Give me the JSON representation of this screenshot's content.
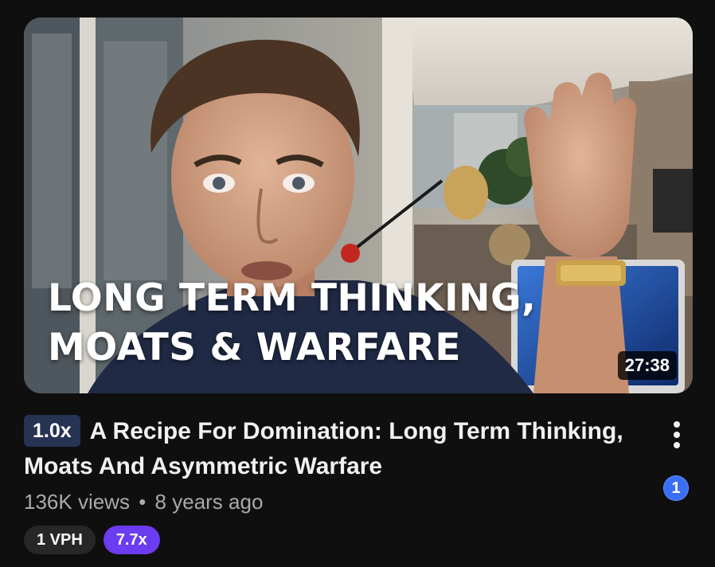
{
  "video": {
    "thumbnail_overlay_text": "LONG TERM THINKING,\nMOATS & WARFARE",
    "duration": "27:38",
    "speed_badge": "1.0x",
    "title": "A Recipe For Domination: Long Term Thinking, Moats And Asymmetric Warfare",
    "views": "136K views",
    "separator": "•",
    "age": "8 years ago",
    "more_icon": "kebab-menu-icon"
  },
  "chips": {
    "vph": "1 VPH",
    "ratio": "7.7x"
  },
  "extension_badge": {
    "label": "1",
    "color": "#3b6ff3"
  },
  "colors": {
    "background": "#0f0f0f",
    "title_text": "#f1f1f1",
    "secondary_text": "#aaaaaa",
    "speed_badge_bg": "#273353",
    "ratio_chip_bg": "#6b3cf0",
    "vph_chip_bg": "#272727"
  }
}
